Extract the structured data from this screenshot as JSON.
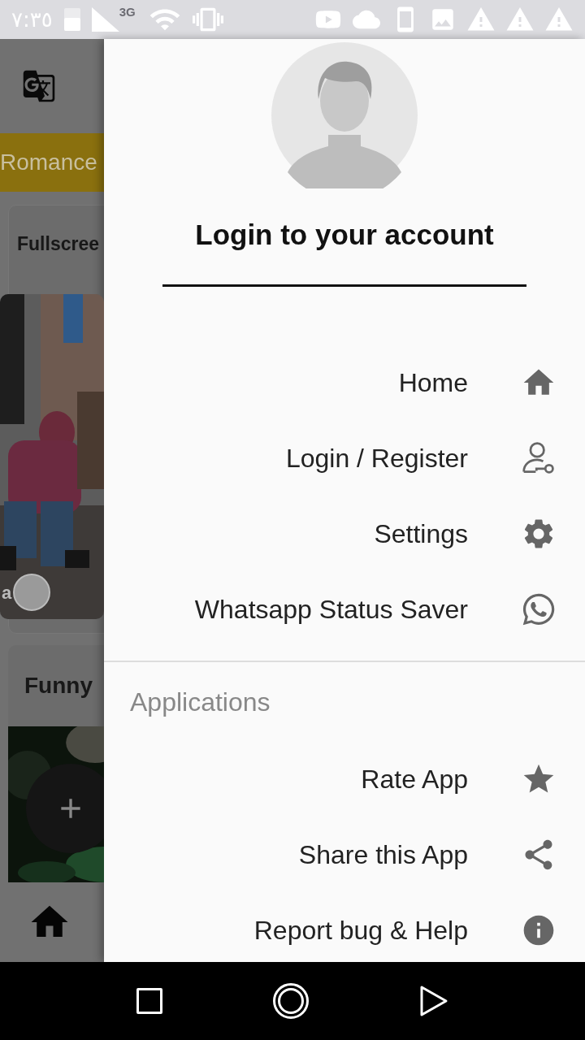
{
  "status_bar": {
    "time": "٧:٣٥",
    "network": "3G"
  },
  "background_app": {
    "category": "Romance",
    "cards": [
      {
        "title": "Fullscree",
        "caption": "a",
        "kind": "street"
      },
      {
        "title": "Funny",
        "kind": "dark"
      }
    ]
  },
  "drawer": {
    "title": "Login to your account",
    "menu": [
      {
        "label": "Home",
        "kind": "home"
      },
      {
        "label": "Login / Register",
        "kind": "user-key"
      },
      {
        "label": "Settings",
        "kind": "settings"
      },
      {
        "label": "Whatsapp Status Saver",
        "kind": "whatsapp"
      }
    ],
    "section_title": "Applications",
    "apps": [
      {
        "label": "Rate App",
        "kind": "star"
      },
      {
        "label": "Share this App",
        "kind": "share"
      },
      {
        "label": "Report bug & Help",
        "kind": "info"
      }
    ]
  }
}
